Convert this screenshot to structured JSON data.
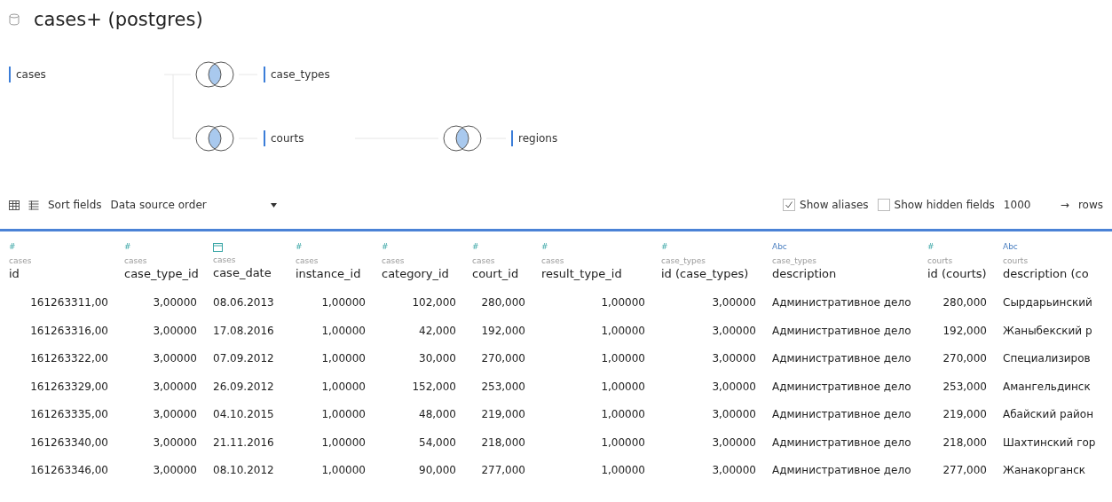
{
  "datasource": {
    "title": "cases+ (postgres)"
  },
  "join_diagram": {
    "tables": [
      {
        "name": "cases",
        "kind": "table"
      },
      {
        "name": "case_types",
        "kind": "join"
      },
      {
        "name": "courts",
        "kind": "join"
      },
      {
        "name": "regions",
        "kind": "join"
      }
    ]
  },
  "toolbar": {
    "sort_label": "Sort fields",
    "sort_value": "Data source order",
    "show_aliases": {
      "label": "Show aliases",
      "checked": true
    },
    "show_hidden": {
      "label": "Show hidden fields",
      "checked": false
    },
    "rows_value": "1000",
    "arrow": "→",
    "rows_label": "rows"
  },
  "table": {
    "columns": [
      {
        "kind": "number",
        "type_label": "#",
        "source": "cases",
        "name": "id"
      },
      {
        "kind": "number",
        "type_label": "#",
        "source": "cases",
        "name": "case_type_id"
      },
      {
        "kind": "date",
        "source": "cases",
        "name": "case_date"
      },
      {
        "kind": "number",
        "type_label": "#",
        "source": "cases",
        "name": "instance_id"
      },
      {
        "kind": "number",
        "type_label": "#",
        "source": "cases",
        "name": "category_id"
      },
      {
        "kind": "number",
        "type_label": "#",
        "source": "cases",
        "name": "court_id"
      },
      {
        "kind": "number",
        "type_label": "#",
        "source": "cases",
        "name": "result_type_id"
      },
      {
        "kind": "number",
        "type_label": "#",
        "source": "case_types",
        "name": "id (case_types)"
      },
      {
        "kind": "string",
        "type_label": "Abc",
        "source": "case_types",
        "name": "description"
      },
      {
        "kind": "number",
        "type_label": "#",
        "source": "courts",
        "name": "id (courts)"
      },
      {
        "kind": "string",
        "type_label": "Abc",
        "source": "courts",
        "name": "description (co"
      }
    ],
    "rows": [
      [
        "161263311,00",
        "3,00000",
        "08.06.2013",
        "1,00000",
        "102,000",
        "280,000",
        "1,00000",
        "3,00000",
        "Административное дело",
        "280,000",
        "Сырдарьинский"
      ],
      [
        "161263316,00",
        "3,00000",
        "17.08.2016",
        "1,00000",
        "42,000",
        "192,000",
        "1,00000",
        "3,00000",
        "Административное дело",
        "192,000",
        "Жаныбекский р"
      ],
      [
        "161263322,00",
        "3,00000",
        "07.09.2012",
        "1,00000",
        "30,000",
        "270,000",
        "1,00000",
        "3,00000",
        "Административное дело",
        "270,000",
        "Специализиров"
      ],
      [
        "161263329,00",
        "3,00000",
        "26.09.2012",
        "1,00000",
        "152,000",
        "253,000",
        "1,00000",
        "3,00000",
        "Административное дело",
        "253,000",
        "Амангельдинск"
      ],
      [
        "161263335,00",
        "3,00000",
        "04.10.2015",
        "1,00000",
        "48,000",
        "219,000",
        "1,00000",
        "3,00000",
        "Административное дело",
        "219,000",
        "Абайский район"
      ],
      [
        "161263340,00",
        "3,00000",
        "21.11.2016",
        "1,00000",
        "54,000",
        "218,000",
        "1,00000",
        "3,00000",
        "Административное дело",
        "218,000",
        "Шахтинский гор"
      ],
      [
        "161263346,00",
        "3,00000",
        "08.10.2012",
        "1,00000",
        "90,000",
        "277,000",
        "1,00000",
        "3,00000",
        "Административное дело",
        "277,000",
        "Жанакорганск"
      ]
    ]
  }
}
